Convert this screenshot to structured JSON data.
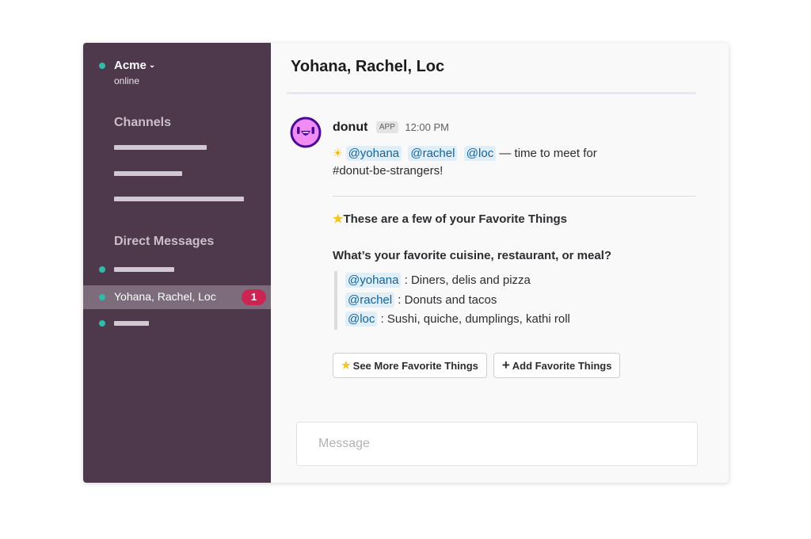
{
  "sidebar": {
    "team_name": "Acme",
    "team_status": "online",
    "channels_title": "Channels",
    "dm_title": "Direct Messages",
    "active_dm": {
      "label": "Yohana, Rachel, Loc",
      "badge": "1"
    },
    "status_color": "#2bbcaa",
    "badge_color": "#cd2553"
  },
  "main": {
    "channel_title": "Yohana, Rachel, Loc",
    "message": {
      "sender": "donut",
      "app_tag": "APP",
      "time": "12:00 PM",
      "mentions": [
        "@yohana",
        "@rachel",
        "@loc"
      ],
      "text_after": "— time to meet for",
      "text_line2": "#donut-be-strangers!",
      "fav_title": "These are a few of your Favorite Things",
      "question": "What’s your favorite cuisine, restaurant, or meal?",
      "answers": [
        {
          "mention": "@yohana",
          "answer": "Diners, delis and pizza"
        },
        {
          "mention": "@rachel",
          "answer": "Donuts and tacos"
        },
        {
          "mention": "@loc",
          "answer": "Sushi, quiche, dumplings, kathi roll"
        }
      ],
      "buttons": {
        "see_more": "See More Favorite Things",
        "add": "Add Favorite Things"
      }
    },
    "composer": {
      "placeholder": "Message"
    }
  }
}
